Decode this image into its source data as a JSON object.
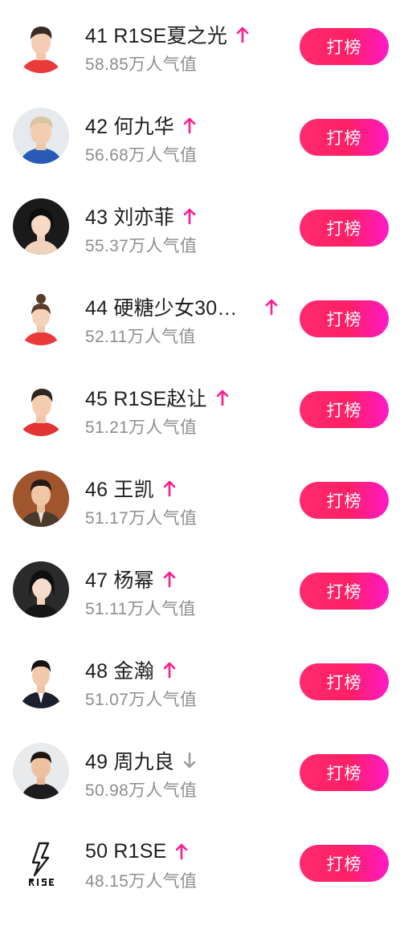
{
  "rank_list": {
    "action_label": "打榜",
    "colors": {
      "accent": "#ff1f66",
      "accent_end": "#ff1bc4",
      "arrow_up": "#ff1b8d",
      "arrow_down": "#9e9e9e"
    },
    "items": [
      {
        "rank": "41",
        "name": "R1SE夏之光",
        "popularity": "58.85万人气值",
        "trend": "up"
      },
      {
        "rank": "42",
        "name": "何九华",
        "popularity": "56.68万人气值",
        "trend": "up"
      },
      {
        "rank": "43",
        "name": "刘亦菲",
        "popularity": "55.37万人气值",
        "trend": "up"
      },
      {
        "rank": "44",
        "name": "硬糖少女30…",
        "popularity": "52.11万人气值",
        "trend": "up"
      },
      {
        "rank": "45",
        "name": "R1SE赵让",
        "popularity": "51.21万人气值",
        "trend": "up"
      },
      {
        "rank": "46",
        "name": "王凯",
        "popularity": "51.17万人气值",
        "trend": "up"
      },
      {
        "rank": "47",
        "name": "杨幂",
        "popularity": "51.11万人气值",
        "trend": "up"
      },
      {
        "rank": "48",
        "name": "金瀚",
        "popularity": "51.07万人气值",
        "trend": "up"
      },
      {
        "rank": "49",
        "name": "周九良",
        "popularity": "50.98万人气值",
        "trend": "down"
      },
      {
        "rank": "50",
        "name": "R1SE",
        "popularity": "48.15万人气值",
        "trend": "up"
      }
    ]
  }
}
